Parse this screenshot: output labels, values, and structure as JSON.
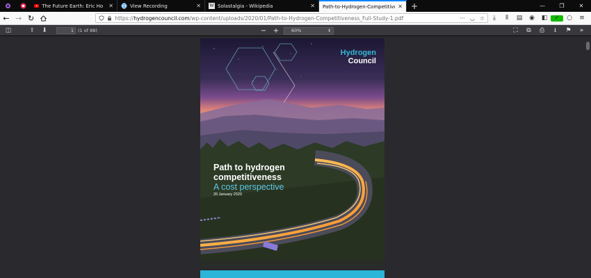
{
  "tabs": [
    {
      "title": "The Future Earth: Eric Holthaus",
      "icon": "youtube-icon",
      "active": false
    },
    {
      "title": "View Recording",
      "icon": "globe-icon",
      "active": false
    },
    {
      "title": "Solastalgia - Wikipedia",
      "icon": "wikipedia-icon",
      "active": false
    },
    {
      "title": "Path-to-Hydrogen-Competitiveness",
      "icon": "pdf-icon",
      "active": true
    }
  ],
  "url": {
    "scheme": "https://",
    "host": "hydrogencouncil.com",
    "path": "/wp-content/uploads/2020/01/Path-to-Hydrogen-Competitiveness_Full-Study-1.pdf"
  },
  "pdf_toolbar": {
    "page_number": "1",
    "page_count": "(1 of 88)",
    "zoom": "60%"
  },
  "cover": {
    "logo_line1": "Hydrogen",
    "logo_line2": "Council",
    "title_line1": "Path to hydrogen",
    "title_line2": "competitiveness",
    "subtitle": "A cost perspective",
    "date": "20 January 2020"
  },
  "colors": {
    "accent": "#0a84ff",
    "brand_cyan": "#33b8d6",
    "brand_cyan_light": "#5ec8e6"
  }
}
